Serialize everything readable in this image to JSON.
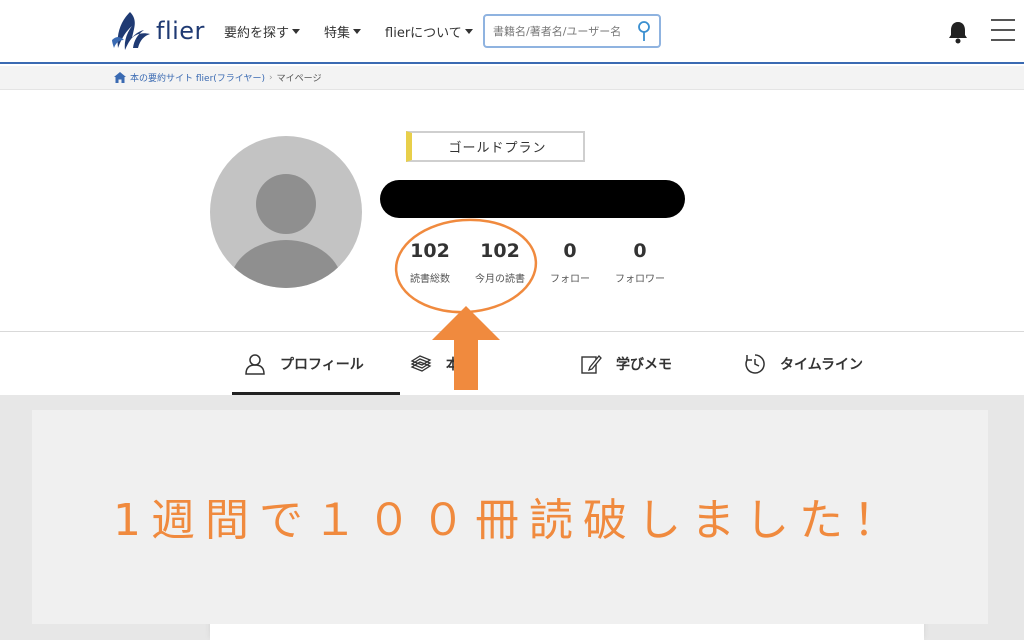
{
  "header": {
    "logo_text": "flier",
    "nav": [
      {
        "label": "要約を探す"
      },
      {
        "label": "特集"
      },
      {
        "label": "flierについて"
      }
    ],
    "search": {
      "placeholder": "書籍名/著者名/ユーザー名"
    }
  },
  "breadcrumb": {
    "home": "本の要約サイト flier(フライヤー)",
    "current": "マイページ"
  },
  "profile": {
    "plan": "ゴールドプラン",
    "stats": [
      {
        "value": "102",
        "label": "読書総数"
      },
      {
        "value": "102",
        "label": "今月の読書"
      },
      {
        "value": "0",
        "label": "フォロー"
      },
      {
        "value": "0",
        "label": "フォロワー"
      }
    ]
  },
  "tabs": [
    {
      "label": "プロフィール"
    },
    {
      "label": "本棚"
    },
    {
      "label": "学びメモ"
    },
    {
      "label": "タイムライン"
    }
  ],
  "overlay": {
    "text": "1週間で１００冊読破しました！"
  },
  "colors": {
    "brand": "#1f3a73",
    "accent_orange": "#f08a3e",
    "gold": "#e8cf4a"
  }
}
